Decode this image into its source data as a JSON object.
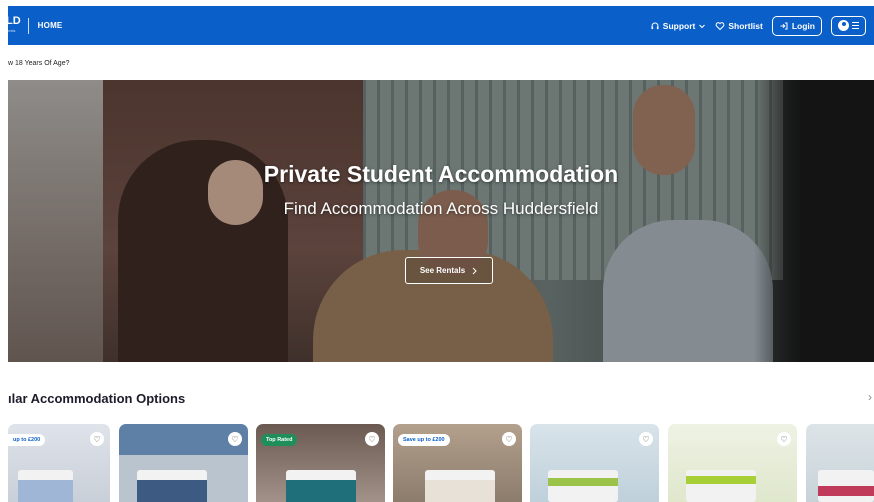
{
  "nav": {
    "logo": "LD",
    "logo_sub": "nexis",
    "home": "HOME",
    "support": "Support",
    "shortlist": "Shortlist",
    "login": "Login",
    "icons": {
      "support": "headset-icon",
      "shortlist": "heart-icon",
      "login": "sign-in-icon",
      "user": "user-icon",
      "menu": "hamburger-icon"
    },
    "accent": "#0b5fc9"
  },
  "notice": "w 18 Years Of Age?",
  "hero": {
    "title": "Private Student Accommodation",
    "subtitle": "Find Accommodation Across Huddersfield",
    "cta": "See Rentals"
  },
  "section": {
    "title": "ılar Accommodation Options"
  },
  "cards": [
    {
      "badge": "up to £200"
    },
    {
      "badge": ""
    },
    {
      "badge": "Top Rated"
    },
    {
      "badge": "Save up to £200"
    },
    {
      "badge": ""
    },
    {
      "badge": ""
    },
    {
      "badge": ""
    }
  ]
}
